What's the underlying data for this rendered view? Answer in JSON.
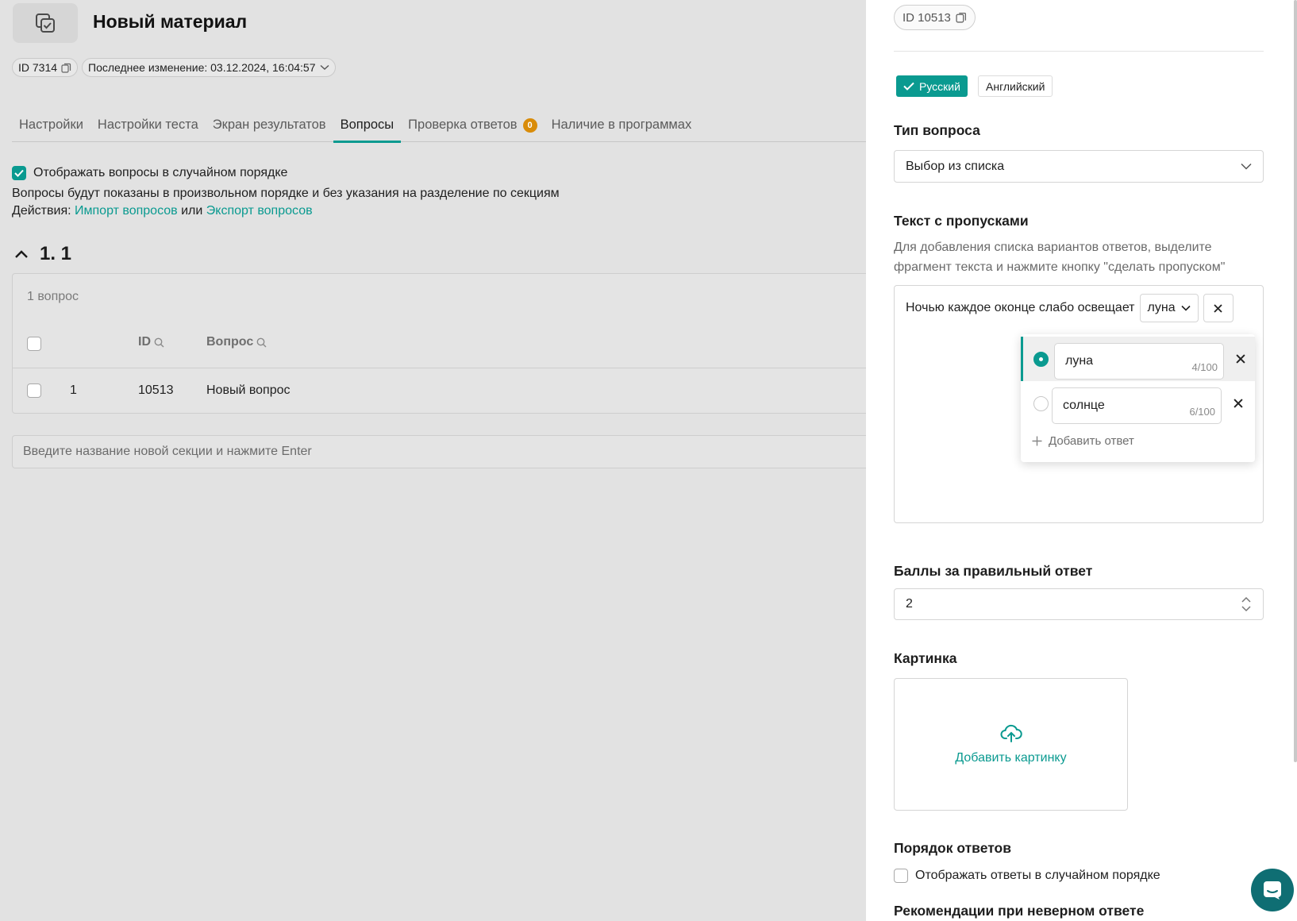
{
  "header": {
    "title": "Новый материал",
    "id_label": "ID 7314",
    "modified_label": "Последнее изменение: 03.12.2024, 16:04:57"
  },
  "tabs": [
    {
      "label": "Настройки"
    },
    {
      "label": "Настройки теста"
    },
    {
      "label": "Экран результатов"
    },
    {
      "label": "Вопросы",
      "active": true
    },
    {
      "label": "Проверка ответов",
      "badge": "0"
    },
    {
      "label": "Наличие в программах"
    }
  ],
  "questions": {
    "random_label": "Отображать вопросы в случайном порядке",
    "random_checked": true,
    "info": "Вопросы будут показаны в произвольном порядке и без указания на разделение по секциям",
    "actions_prefix": "Действия:",
    "import_link": "Импорт вопросов",
    "or_text": "или",
    "export_link": "Экспорт вопросов",
    "section_title": "1. 1",
    "count_label": "1 вопрос",
    "col_id": "ID",
    "col_question": "Вопрос",
    "rows": [
      {
        "num": "1",
        "id": "10513",
        "question": "Новый вопрос"
      }
    ],
    "new_section_placeholder": "Введите название новой секции и нажмите Enter"
  },
  "panel": {
    "id_label": "ID 10513",
    "lang_ru": "Русский",
    "lang_en": "Английский",
    "type_label": "Тип вопроса",
    "type_value": "Выбор из списка",
    "gaps_label": "Текст с пропусками",
    "gaps_hint": "Для добавления списка вариантов ответов, выделите фрагмент текста и нажмите кнопку \"сделать пропуском\"",
    "gap_text": "Ночью каждое оконце слабо освещает",
    "gap_selected": "луна",
    "options": [
      {
        "text": "луна",
        "count": "4",
        "max": "/100",
        "correct": true
      },
      {
        "text": "солнце",
        "count": "6",
        "max": "/100",
        "correct": false
      }
    ],
    "add_answer": "Добавить ответ",
    "score_label": "Баллы за правильный ответ",
    "score_value": "2",
    "image_label": "Картинка",
    "image_add": "Добавить картинку",
    "order_label": "Порядок ответов",
    "order_checkbox": "Отображать ответы в случайном порядке",
    "recommend_label": "Рекомендации при неверном ответе"
  },
  "colors": {
    "accent": "#0a9a90",
    "badge": "#d98c09",
    "chat": "#0f6e73"
  }
}
